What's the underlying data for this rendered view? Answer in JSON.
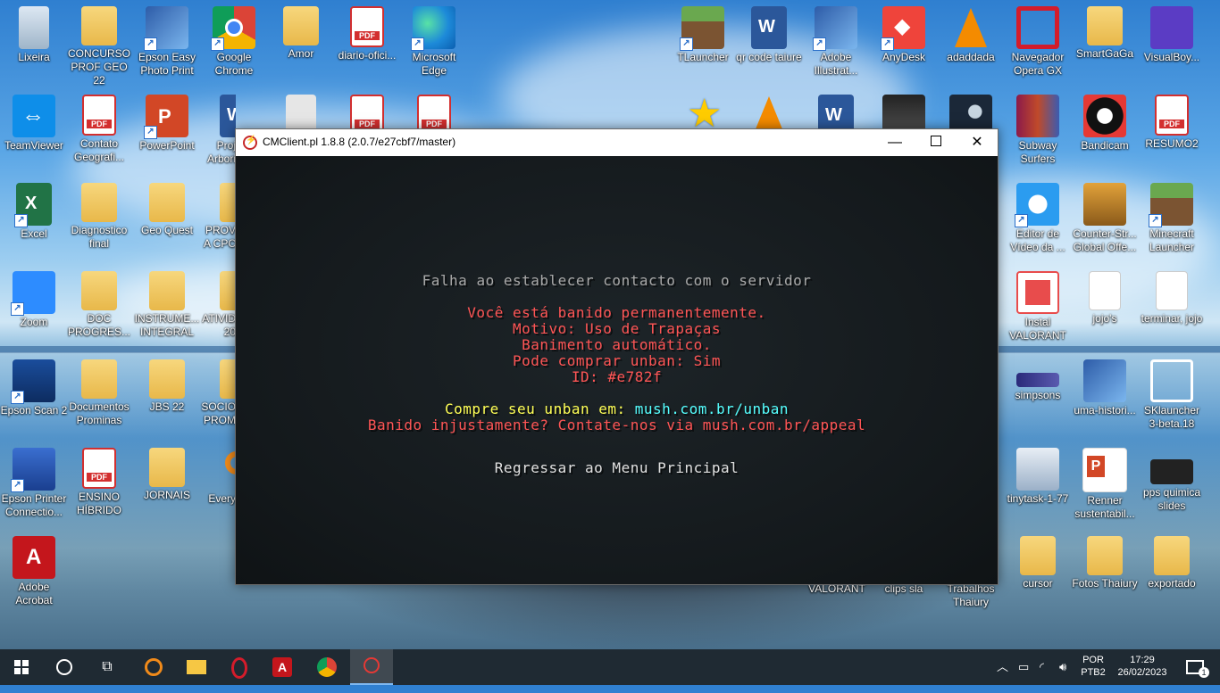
{
  "desktop": {
    "icons_left": [
      {
        "label": "Lixeira",
        "icon": "recycle-bin-icon"
      },
      {
        "label": "CONCURSO PROF GEO 22",
        "icon": "folder-icon"
      },
      {
        "label": "Epson Easy Photo Print",
        "icon": "epson-photo-icon"
      },
      {
        "label": "Google Chrome",
        "icon": "chrome-icon"
      },
      {
        "label": "Amor",
        "icon": "folder-icon"
      },
      {
        "label": "diario-ofici...",
        "icon": "pdf-icon"
      },
      {
        "label": "Microsoft Edge",
        "icon": "edge-icon"
      },
      {
        "label": "TeamViewer",
        "icon": "teamviewer-icon"
      },
      {
        "label": "Contato Geografi...",
        "icon": "pdf-icon"
      },
      {
        "label": "PowerPoint",
        "icon": "powerpoint-icon"
      },
      {
        "label": "Proj Arbori",
        "icon": "word-doc-icon"
      },
      {
        "label": "Excel",
        "icon": "excel-icon"
      },
      {
        "label": "Diagnostico final",
        "icon": "folder-icon"
      },
      {
        "label": "Geo Quest",
        "icon": "folder-icon"
      },
      {
        "label": "PROVA CPC",
        "icon": "folder-icon"
      },
      {
        "label": "Zoom",
        "icon": "zoom-icon"
      },
      {
        "label": "DOC PROGRES...",
        "icon": "folder-icon"
      },
      {
        "label": "INSTRUME... INTEGRAL",
        "icon": "folder-icon"
      },
      {
        "label": "ATIVID 20",
        "icon": "folder-icon"
      },
      {
        "label": "Epson Scan 2",
        "icon": "scanner-icon"
      },
      {
        "label": "Documentos Prominas",
        "icon": "folder-icon"
      },
      {
        "label": "JBS 22",
        "icon": "folder-icon"
      },
      {
        "label": "SOCIO PROM",
        "icon": "folder-icon"
      },
      {
        "label": "Epson Printer Connectio...",
        "icon": "printer-icon"
      },
      {
        "label": "ENSINO HÍBRIDO",
        "icon": "pdf-icon"
      },
      {
        "label": "JORNAIS",
        "icon": "folder-icon"
      },
      {
        "label": "Every",
        "icon": "search-everything-icon"
      },
      {
        "label": "Adobe Acrobat",
        "icon": "acrobat-icon"
      }
    ],
    "icons_right": [
      {
        "label": "TLauncher",
        "icon": "minecraft-icon"
      },
      {
        "label": "qr code taiure",
        "icon": "word-doc-icon"
      },
      {
        "label": "Adobe Illustrat...",
        "icon": "photo-icon"
      },
      {
        "label": "AnyDesk",
        "icon": "anydesk-icon"
      },
      {
        "label": "adaddada",
        "icon": "vlc-icon"
      },
      {
        "label": "Navegador Opera GX",
        "icon": "opera-icon"
      },
      {
        "label": "SmartGaGa",
        "icon": "folder-icon"
      },
      {
        "label": "VisualBoy...",
        "icon": "gameboy-icon"
      },
      {
        "label": "Subway Surfers",
        "icon": "winrar-icon"
      },
      {
        "label": "Bandicam",
        "icon": "bandicam-icon"
      },
      {
        "label": "RESUMO2",
        "icon": "pdf-icon"
      },
      {
        "label": "Editor de Vídeo da ...",
        "icon": "video-editor-icon"
      },
      {
        "label": "Counter-Str... Global Offe...",
        "icon": "csgo-icon"
      },
      {
        "label": "Minecraft Launcher",
        "icon": "minecraft-icon"
      },
      {
        "label": "Instal VALORANT",
        "icon": "valorant-icon"
      },
      {
        "label": "jojo's",
        "icon": "document-icon"
      },
      {
        "label": "terminar, jojo",
        "icon": "document-icon"
      },
      {
        "label": "simpsons",
        "icon": "simpsons-icon"
      },
      {
        "label": "uma-histori...",
        "icon": "photo-icon"
      },
      {
        "label": "SKlauncher 3-beta.18",
        "icon": "sklauncher-icon"
      },
      {
        "label": "tinytask-1-77",
        "icon": "tinytask-icon"
      },
      {
        "label": "Renner sustentabil...",
        "icon": "powerpoint-file-icon"
      },
      {
        "label": "pps quimica slides",
        "icon": "crack-icon"
      },
      {
        "label": "VALORANT",
        "icon": ""
      },
      {
        "label": "clips sla",
        "icon": ""
      },
      {
        "label": "Trabalhos Thaiury",
        "icon": ""
      },
      {
        "label": "cursor",
        "icon": "folder-icon"
      },
      {
        "label": "Fotos Thaiury",
        "icon": "folder-icon"
      },
      {
        "label": "exportado",
        "icon": "folder-icon"
      }
    ]
  },
  "window": {
    "title": "CMClient.pl 1.8.8 (2.0.7/e27cbf7/master)",
    "minimize": "—",
    "close": "✕"
  },
  "game": {
    "heading": "Falha ao establecer contacto com o servidor",
    "ban_lines": [
      "Você está banido permanentemente.",
      "Motivo: Uso de Trapaças",
      "Banimento automático.",
      "Pode comprar unban: Sim",
      "ID: #e782f"
    ],
    "unban_prefix": "Compre seu unban em: ",
    "unban_link": "mush.com.br/unban",
    "appeal": "Banido injustamente? Contate-nos via mush.com.br/appeal",
    "back_button": "Regressar ao Menu Principal",
    "colors": {
      "gray": "#a9a9a9",
      "red": "#ff5555",
      "yellow": "#ffff55",
      "aqua": "#55ffff"
    }
  },
  "taskbar": {
    "items": [
      "start-icon",
      "search-icon",
      "task-view-icon",
      "everything-search-icon",
      "file-explorer-icon",
      "opera-icon",
      "acrobat-icon",
      "chrome-icon",
      "cmclient-icon"
    ],
    "lang_top": "POR",
    "lang_bottom": "PTB2",
    "time": "17:29",
    "date": "26/02/2023",
    "notification_count": "1"
  }
}
